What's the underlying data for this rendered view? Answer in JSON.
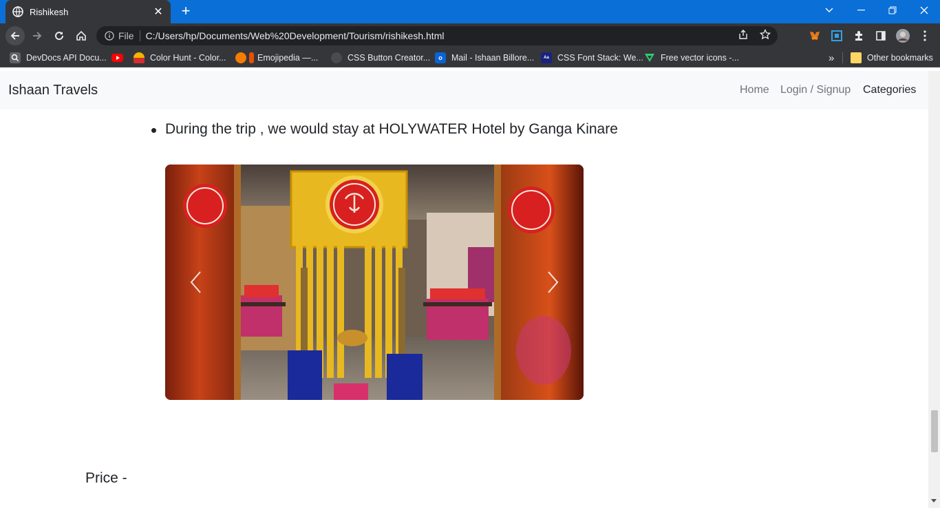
{
  "browser": {
    "tab": {
      "title": "Rishikesh",
      "favicon": "globe-icon"
    },
    "address": {
      "scheme_label": "File",
      "url": "C:/Users/hp/Documents/Web%20Development/Tourism/rishikesh.html"
    },
    "bookmarks": [
      {
        "label": "DevDocs API Docu...",
        "icon": "devdocs-icon",
        "color": "#e8eaed"
      },
      {
        "label": "",
        "icon": "youtube-icon",
        "color": "#ff0000"
      },
      {
        "label": "Color Hunt - Color...",
        "icon": "colorhunt-icon",
        "color": "#f4b400"
      },
      {
        "label": "Emojipedia —...",
        "icon": "emojipedia-icon",
        "color": "#f57c00"
      },
      {
        "label": "CSS Button Creator...",
        "icon": "css-button-icon",
        "color": "#5f6368"
      },
      {
        "label": "Mail - Ishaan Billore...",
        "icon": "outlook-icon",
        "color": "#0a64d6"
      },
      {
        "label": "CSS Font Stack: We...",
        "icon": "fontstack-icon",
        "color": "#1a237e"
      },
      {
        "label": "Free vector icons -...",
        "icon": "flaticon-icon",
        "color": "#2ecc71"
      }
    ],
    "overflow_label": "»",
    "other_bookmarks": "Other bookmarks"
  },
  "site": {
    "brand": "Ishaan Travels",
    "nav": [
      {
        "label": "Home",
        "active": false
      },
      {
        "label": "Login / Signup",
        "active": false
      },
      {
        "label": "Categories",
        "active": true
      }
    ],
    "stay_text": "During the trip , we would stay at HOLYWATER Hotel by Ganga Kinare",
    "carousel": {
      "prev": "‹",
      "next": "›",
      "image_subject": "hotel-restaurant-interior"
    },
    "price_label": "Price -"
  },
  "colors": {
    "titlebar": "#0a6fd6",
    "chrome": "#35363a",
    "navbar_bg": "#f8f9fa",
    "text": "#212529",
    "muted": "#6c757d"
  }
}
